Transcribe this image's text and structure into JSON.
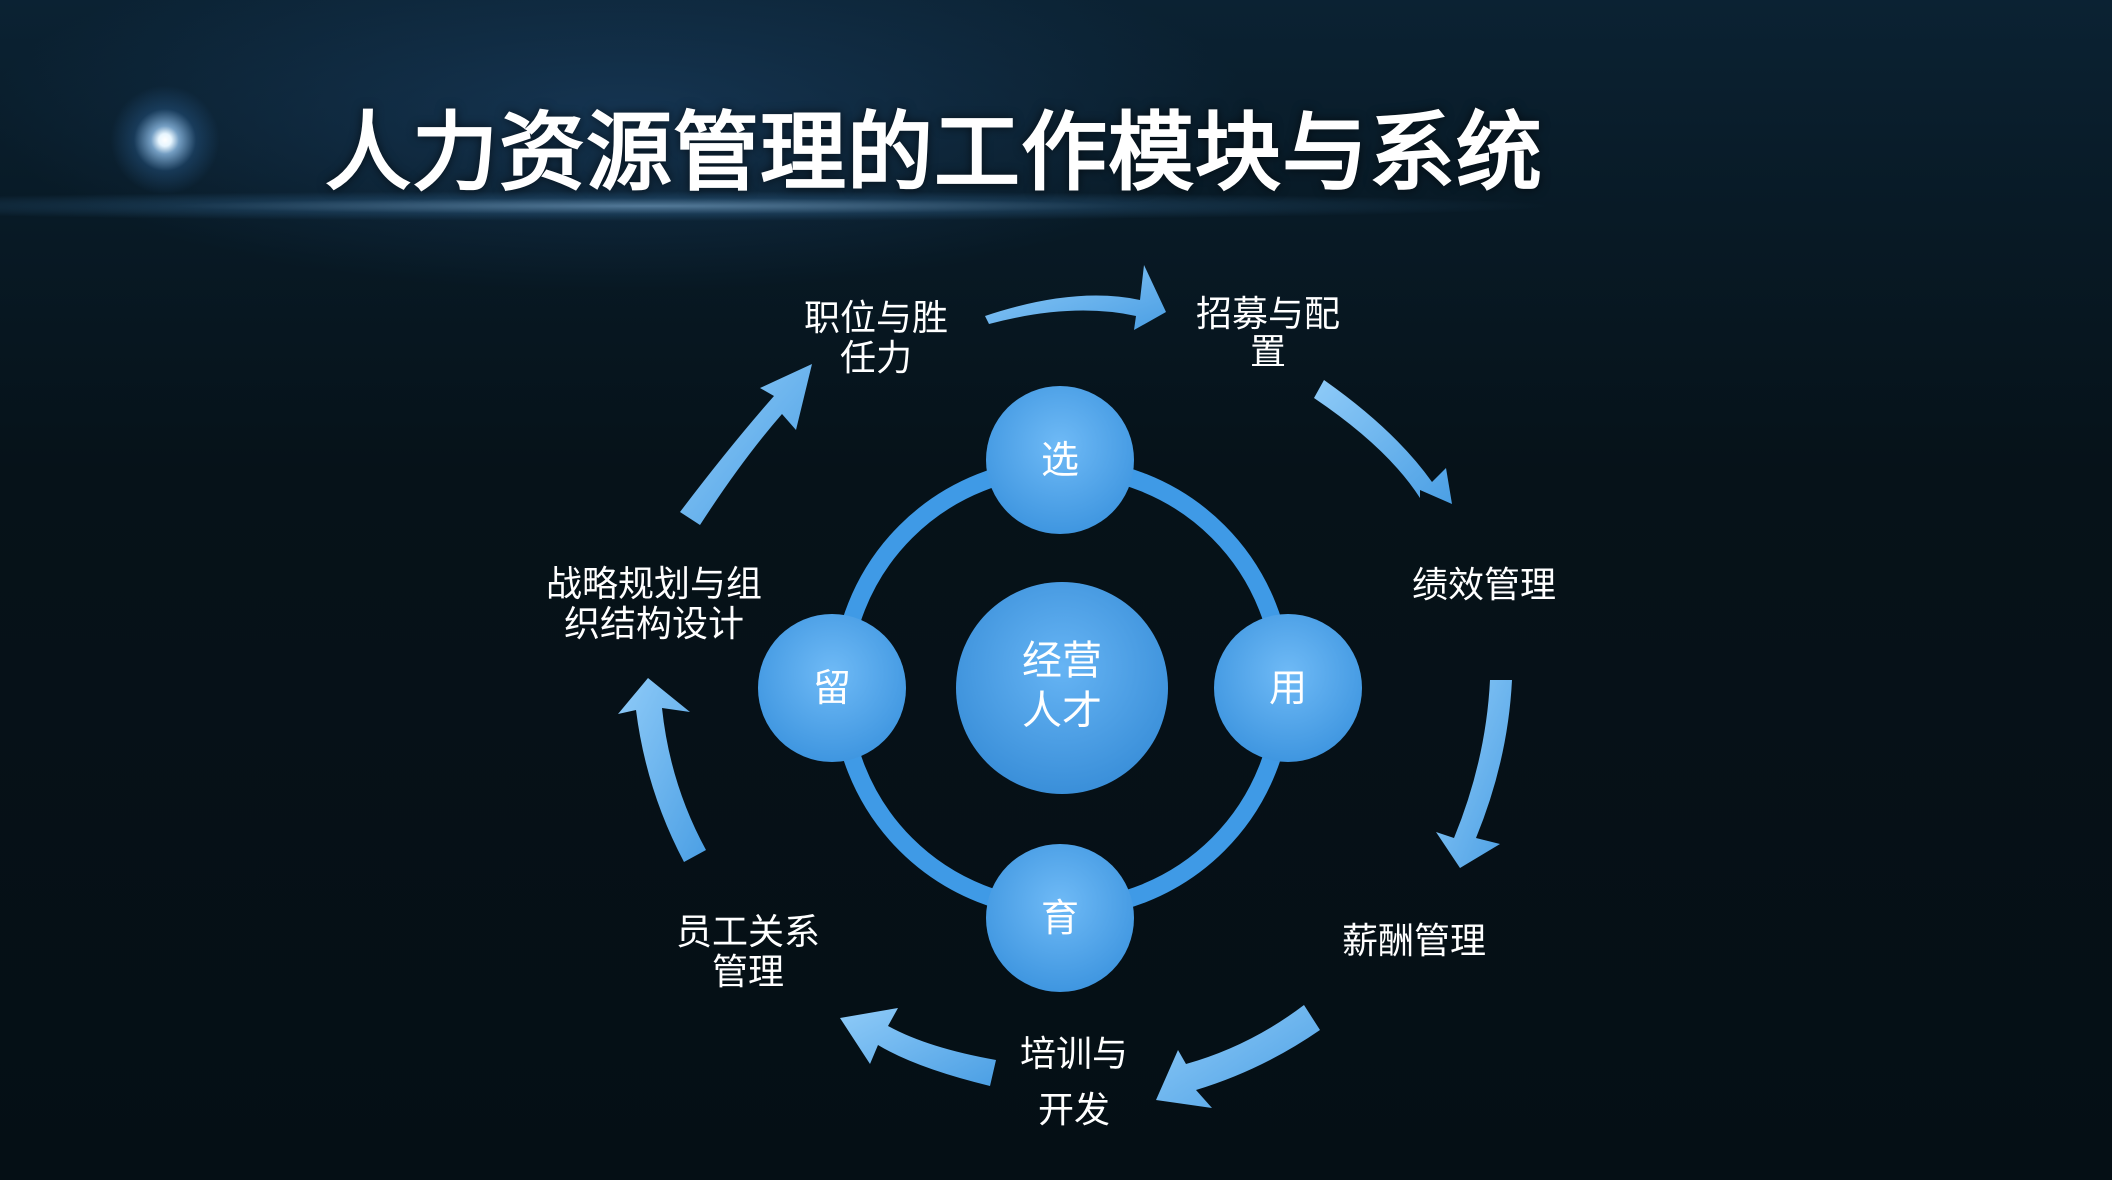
{
  "title": "人力资源管理的工作模块与系统",
  "center": {
    "line1": "经营",
    "line2": "人才"
  },
  "inner_nodes": {
    "top": "选",
    "right": "用",
    "bottom": "育",
    "left": "留"
  },
  "modules": {
    "job": [
      "职位与胜",
      "任力"
    ],
    "recruit": [
      "招募与配",
      "置"
    ],
    "performance": [
      "绩效管理"
    ],
    "salary": [
      "薪酬管理"
    ],
    "training": [
      "培训与",
      "开发"
    ],
    "relations": [
      "员工关系",
      "管理"
    ],
    "strategy": [
      "战略规划与组",
      "织结构设计"
    ]
  },
  "colors": {
    "background": "#06131c",
    "arrow": "#5fb2f2",
    "node": "#4ea6ee",
    "ring": "#3f9ae6"
  }
}
